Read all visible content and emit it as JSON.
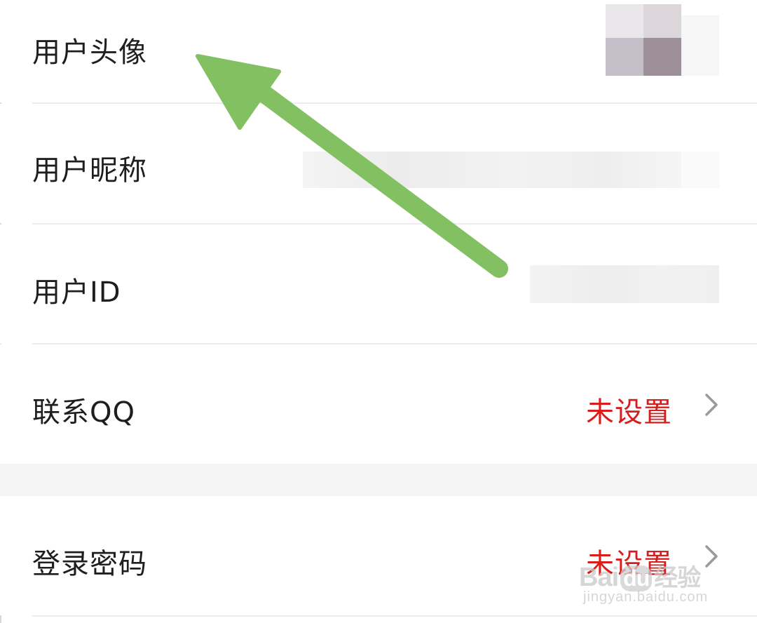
{
  "rows": [
    {
      "label": "用户头像"
    },
    {
      "label": "用户昵称"
    },
    {
      "label": "用户ID"
    },
    {
      "label": "联系QQ",
      "value": "未设置"
    },
    {
      "label": "登录密码",
      "value": "未设置"
    }
  ],
  "icons": {
    "chevron": "chevron-right-icon",
    "arrow": "annotation-arrow"
  },
  "colors": {
    "accent_red": "#d91c1c",
    "arrow_green": "#83c062",
    "gap_bg": "#f5f5f5"
  },
  "watermark": {
    "brand_latin_1": "Bai",
    "brand_latin_2": "du",
    "brand_cn": "经验",
    "url": "jingyan.baidu.com"
  }
}
